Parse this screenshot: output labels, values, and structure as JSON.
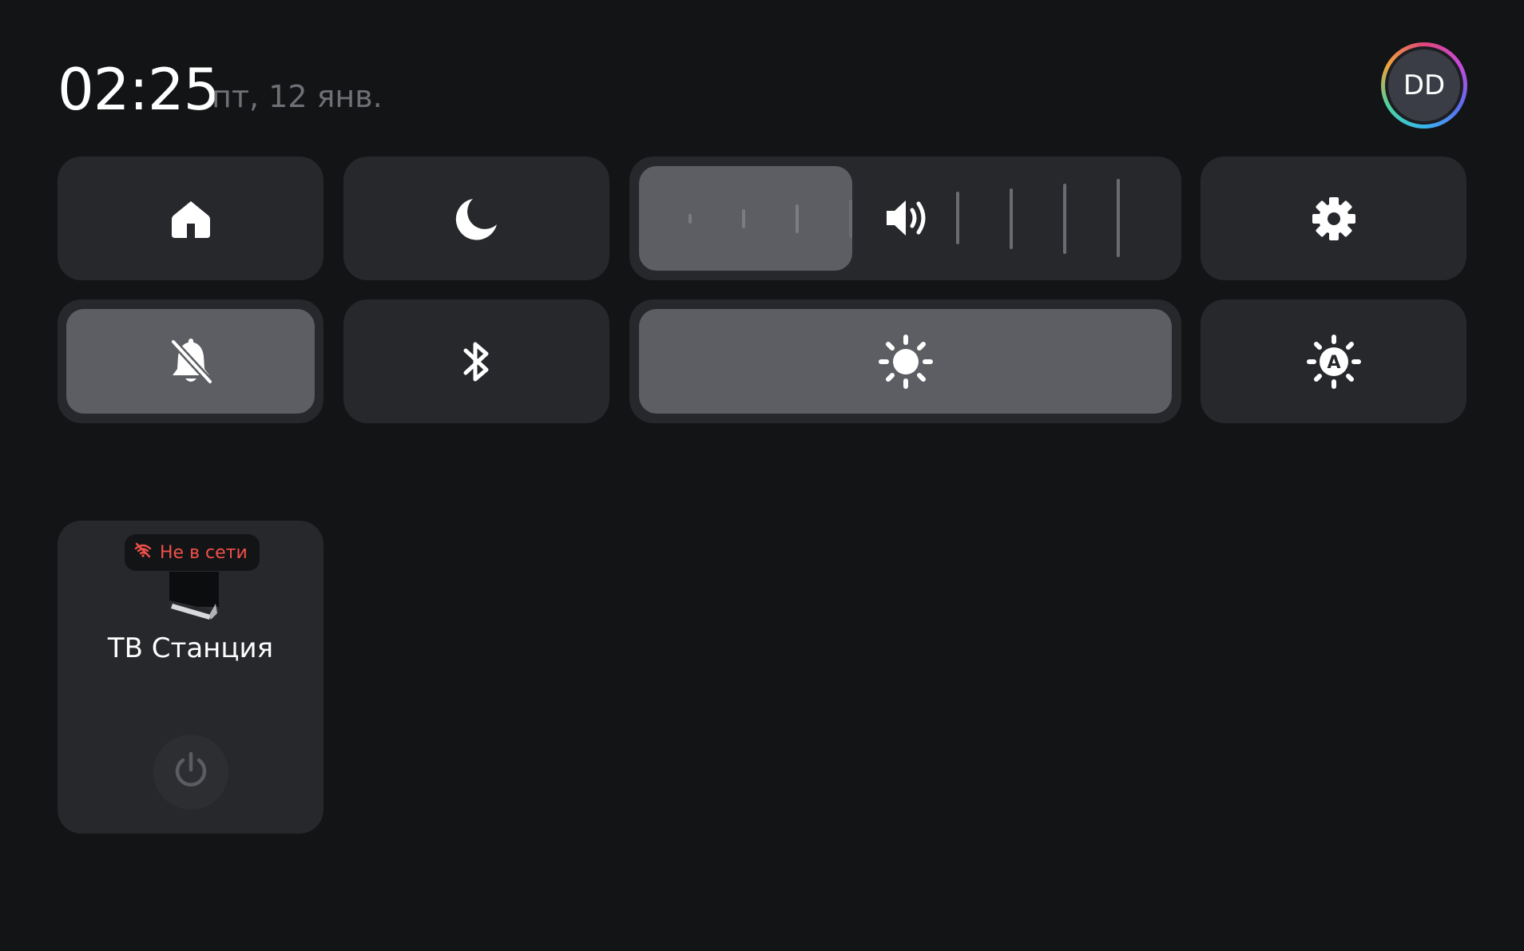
{
  "status": {
    "time": "02:25",
    "date": "пт, 12 янв."
  },
  "user": {
    "initials": "DD"
  },
  "tiles": {
    "home": {
      "icon": "home-icon"
    },
    "night_mode": {
      "icon": "moon-icon"
    },
    "volume": {
      "icon": "speaker-icon",
      "level": 0.4
    },
    "settings": {
      "icon": "gear-icon"
    },
    "do_not_disturb": {
      "icon": "bell-off-icon",
      "active": true
    },
    "bluetooth": {
      "icon": "bluetooth-icon"
    },
    "brightness": {
      "icon": "sun-icon",
      "level": 1.0
    },
    "auto_brightness": {
      "icon": "auto-brightness-icon",
      "glyph": "A"
    }
  },
  "devices": [
    {
      "name": "ТВ Станция",
      "status": "Не в сети",
      "status_icon": "wifi-off-icon",
      "action_icon": "power-icon"
    }
  ],
  "colors": {
    "background": "#131416",
    "tile": "#27282c",
    "tile_active": "#5c5e63",
    "offline": "#f0504a"
  }
}
